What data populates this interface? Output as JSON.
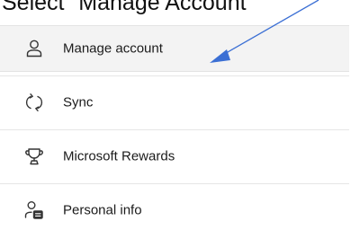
{
  "caption": "Select \"Manage Account\"",
  "menu": {
    "items": [
      {
        "label": "Manage account",
        "icon": "person-icon"
      },
      {
        "label": "Sync",
        "icon": "sync-icon"
      },
      {
        "label": "Microsoft Rewards",
        "icon": "rewards-trophy-icon"
      },
      {
        "label": "Personal info",
        "icon": "personal-info-icon"
      }
    ]
  },
  "colors": {
    "arrow": "#3b6fd4",
    "highlight": "#f3f3f3",
    "text": "#1b1b1b"
  }
}
